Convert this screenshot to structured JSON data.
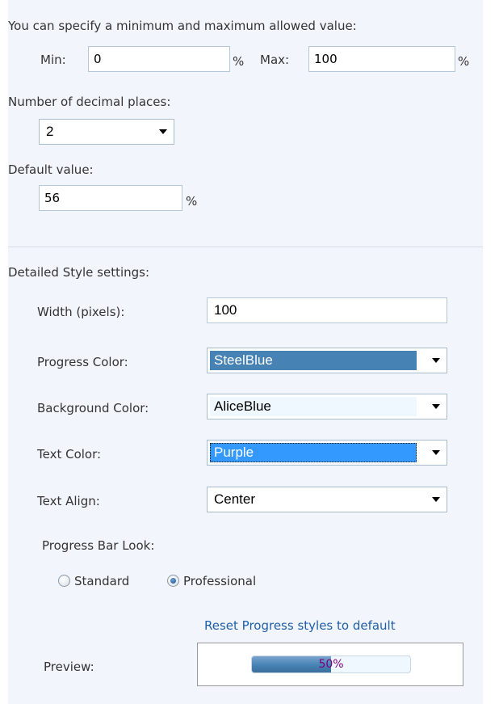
{
  "limits": {
    "intro": "You can specify a minimum and maximum allowed value:",
    "min_label": "Min:",
    "min_value": "0",
    "min_unit": "%",
    "max_label": "Max:",
    "max_value": "100",
    "max_unit": "%"
  },
  "decimals": {
    "label": "Number of decimal places:",
    "selected": "2"
  },
  "default": {
    "label": "Default value:",
    "value": "56",
    "unit": "%"
  },
  "style": {
    "heading": "Detailed Style settings:",
    "width_label": "Width (pixels):",
    "width_value": "100",
    "progress_color_label": "Progress Color:",
    "progress_color_value": "SteelBlue",
    "progress_color_hex": "#4682B4",
    "background_color_label": "Background Color:",
    "background_color_value": "AliceBlue",
    "background_color_hex": "#F0F8FF",
    "text_color_label": "Text Color:",
    "text_color_value": "Purple",
    "text_color_highlight_hex": "#3399FF",
    "text_align_label": "Text Align:",
    "text_align_value": "Center",
    "look_label": "Progress Bar Look:",
    "look_options": [
      "Standard",
      "Professional"
    ],
    "look_selected": "Professional",
    "reset_link": "Reset Progress styles to default"
  },
  "preview": {
    "label": "Preview:",
    "progress_percent": 50,
    "progress_text": "50%",
    "text_color_hex": "#800080"
  }
}
